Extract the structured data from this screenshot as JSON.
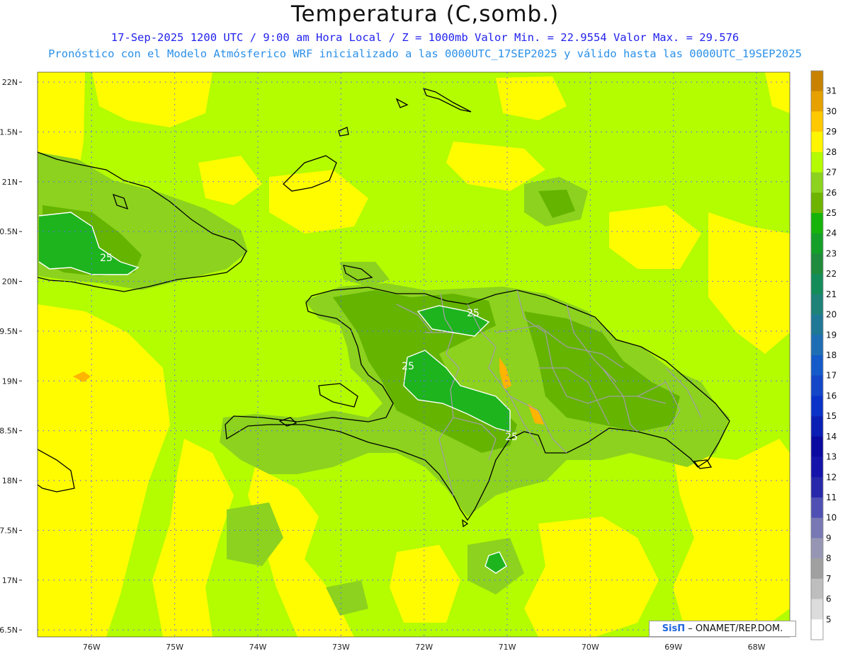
{
  "title": "Temperatura (C,somb.)",
  "subtitle_line1": "17-Sep-2025  1200 UTC / 9:00 am Hora Local / Z = 1000mb   Valor Min. = 22.9554  Valor Max. = 29.576",
  "subtitle_line2": "Pronóstico con el Modelo Atmósferico WRF inicializado a las 0000UTC_17SEP2025 y válido hasta las  0000UTC_19SEP2025",
  "credit": {
    "logo": "SisΠ",
    "text": "– ONAMET/REP.DOM."
  },
  "colors": {
    "background_field": "#b4fc00",
    "warm_band": "#fffc00",
    "cool_lowland": "#8cd21e",
    "cool_highland": "#64b400",
    "core": "#1eb41e",
    "hot_spot": "#ffb400",
    "coastline": "#000000",
    "province_border": "#a0a0a0",
    "grid": "#6060ff",
    "contour": "#ffffff"
  },
  "map_data": {
    "lon_range": [
      -76.65,
      -67.6
    ],
    "lat_range": [
      16.43,
      22.1
    ],
    "lon_ticks": [
      "76W",
      "75W",
      "74W",
      "73W",
      "72W",
      "71W",
      "70W",
      "69W",
      "68W"
    ],
    "lat_ticks": [
      "22N",
      "1.5N",
      "21N",
      "0.5N",
      "20N",
      "9.5N",
      "19N",
      "8.5N",
      "18N",
      "7.5N",
      "17N",
      "6.5N"
    ],
    "contour_labels": [
      "25",
      "25",
      "25",
      "25"
    ]
  },
  "colorbar": {
    "labels": [
      "31",
      "30",
      "29",
      "28",
      "27",
      "26",
      "25",
      "24",
      "23",
      "22",
      "21",
      "20",
      "19",
      "18",
      "17",
      "16",
      "15",
      "14",
      "13",
      "12",
      "11",
      "10",
      "9",
      "8",
      "7",
      "6",
      "5"
    ],
    "colors": [
      "#c88200",
      "#e6a000",
      "#ffc800",
      "#fff500",
      "#b4fa00",
      "#8cd21e",
      "#6eb400",
      "#16b40a",
      "#14a028",
      "#1e8c3c",
      "#148c5a",
      "#1e8278",
      "#1e7896",
      "#1e6eb4",
      "#145ac8",
      "#1446c8",
      "#0a32c8",
      "#0a1eb4",
      "#0a0aa0",
      "#1414aa",
      "#2828aa",
      "#5050b4",
      "#7878b4",
      "#9696b4",
      "#a0a0a0",
      "#bebebe",
      "#dcdcdc",
      "#ffffff"
    ]
  }
}
